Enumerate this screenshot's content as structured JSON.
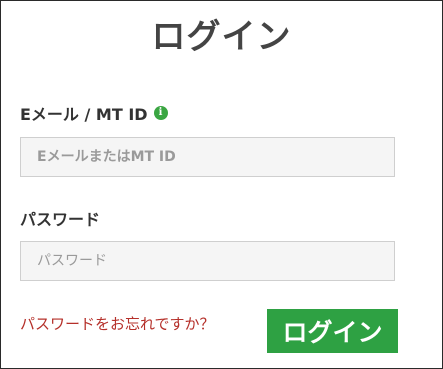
{
  "form": {
    "title": "ログイン",
    "email": {
      "label": "Eメール / MT ID",
      "info_icon": "info-icon",
      "placeholder": "EメールまたはMT ID",
      "value": ""
    },
    "password": {
      "label": "パスワード",
      "placeholder": "パスワード",
      "value": ""
    },
    "forgot_link": "パスワードをお忘れですか？",
    "submit_label": "ログイン"
  },
  "colors": {
    "accent_green": "#2ea143",
    "info_icon_green": "#3aa642",
    "link_red": "#b5302a",
    "title_gray": "#444444",
    "input_bg": "#f5f5f5",
    "input_border": "#cfcfcf",
    "frame_border": "#2a2a2a"
  }
}
